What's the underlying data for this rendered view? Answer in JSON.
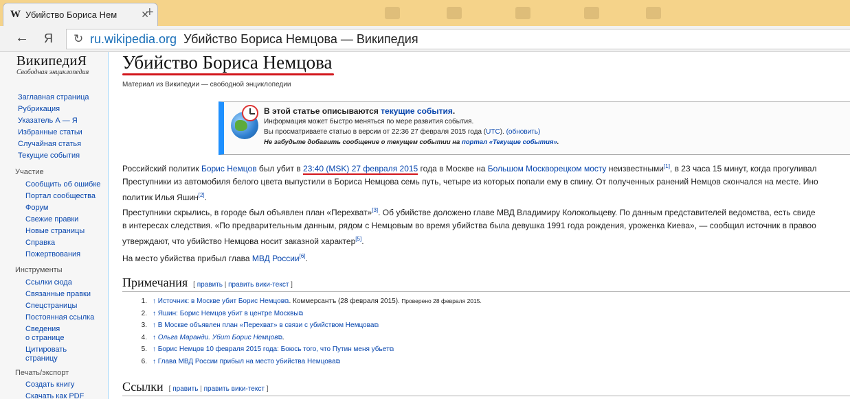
{
  "browser": {
    "tab_favicon": "W",
    "tab_title": "Убийство Бориса Нем",
    "tab_close": "✕",
    "new_tab": "+",
    "back_icon": "←",
    "yandex_label": "Я",
    "reload_icon": "↻",
    "domain": "ru.wikipedia.org",
    "page_title": "Убийство Бориса Немцова — Википедия"
  },
  "sidebar": {
    "logo_main": "ВикипедиЯ",
    "logo_sub": "Свободная энциклопедия",
    "main_nav": [
      "Заглавная страница",
      "Рубрикация",
      "Указатель А — Я",
      "Избранные статьи",
      "Случайная статья",
      "Текущие события"
    ],
    "participation": {
      "heading": "Участие",
      "items": [
        "Сообщить об ошибке",
        "Портал сообщества",
        "Форум",
        "Свежие правки",
        "Новые страницы",
        "Справка",
        "Пожертвования"
      ]
    },
    "tools": {
      "heading": "Инструменты",
      "items": [
        "Ссылки сюда",
        "Связанные правки",
        "Спецстраницы",
        "Постоянная ссылка"
      ],
      "item_info_1": "Сведения",
      "item_info_2": "о странице",
      "item_cite_1": "Цитировать",
      "item_cite_2": "страницу"
    },
    "print": {
      "heading": "Печать/экспорт",
      "items": [
        "Создать книгу",
        "Скачать как PDF"
      ]
    }
  },
  "article": {
    "title": "Убийство Бориса Немцова",
    "site_sub": "Материал из Википедии — свободной энциклопедии",
    "ambox": {
      "line1_a": "В этой статье описываются ",
      "line1_link": "текущие события",
      "line1_b": ".",
      "line2": "Информация может быстро меняться по мере развития события.",
      "line3_a": "Вы просматриваете статью в версии от 22:36 27 февраля 2015 года (",
      "line3_utc": "UTC",
      "line3_b": "). ",
      "line3_update": "(обновить)",
      "line4_a": "Не забудьте добавить сообщение о текущем событии на ",
      "line4_link": "портал «Текущие события»",
      "line4_b": "."
    },
    "p1": {
      "t1": "Российский политик ",
      "link1": "Борис Немцов",
      "t2": " был убит в ",
      "time": "23:40",
      "msk": "(MSK)",
      "date": "27 февраля 2015",
      "t3": " года в Москве на ",
      "link2": "Большом Москворецком мосту",
      "t4": " неизвестными",
      "ref1": "[1]",
      "t5": ", в 23 часа 15 минут, когда прогуливал",
      "line2": "Преступники из автомобиля белого цвета выпустили в Бориса Немцова семь путь, четыре из которых попали ему в спину. От полученных ранений Немцов скончался на месте. Ино",
      "line3": "политик Илья Яшин",
      "ref2": "[2]",
      "line3_end": "."
    },
    "p2": {
      "line1": "Преступники скрылись, в городе был объявлен план «Перехват»",
      "ref3": "[3]",
      "line1_end": ". Об убийстве доложено главе МВД Владимиру Колокольцеву. По данным представителей ведомства, есть свиде",
      "line2": "в интересах следствия. «По предварительным данным, рядом с Немцовым во время убийства была девушка 1991 года рождения, уроженка Киева», — сообщил источник в правоо",
      "line3": "утверждают, что убийство Немцова носит заказной характер",
      "ref5": "[5]",
      "line3_end": "."
    },
    "p3": {
      "t1": "На место убийства прибыл глава ",
      "link": "МВД России",
      "ref6": "[6]",
      "t2": "."
    },
    "notes": {
      "heading": "Примечания",
      "edit_open": "[ ",
      "edit": "править",
      "sep": " | ",
      "edit_source": "править вики-текст",
      "edit_close": " ]",
      "refs": [
        {
          "num": "1.",
          "arrow": "↑",
          "text": "Источник: в Москве убит Борис Немцов",
          "tail": ". Коммерсантъ (28 февраля 2015).",
          "small": " Проверено 28 февраля 2015."
        },
        {
          "num": "2.",
          "arrow": "↑",
          "text": "Яшин: Борис Немцов убит в центре Москвы",
          "tail": "",
          "small": ""
        },
        {
          "num": "3.",
          "arrow": "↑",
          "text": "В Москве объявлен план «Перехват» в связи с убийством Немцова",
          "tail": "",
          "small": ""
        },
        {
          "num": "4.",
          "arrow": "↑",
          "text": "Ольга Маранди. Убит Борис Немцов",
          "tail": ".",
          "small": ""
        },
        {
          "num": "5.",
          "arrow": "↑",
          "text": "Борис Немцов 10 февраля 2015 года: Боюсь того, что Путин меня убьет",
          "tail": "",
          "small": ""
        },
        {
          "num": "6.",
          "arrow": "↑",
          "text": "Глава МВД России прибыл на место убийства Немцова",
          "tail": "",
          "small": ""
        }
      ]
    },
    "links": {
      "heading": "Ссылки",
      "edit_open": "[ ",
      "edit": "править",
      "sep": " | ",
      "edit_source": "править вики-текст",
      "edit_close": " ]"
    }
  },
  "colors": {
    "link": "#0645ad",
    "underline_mark": "#d2151b",
    "ambox_accent": "#1e90ff",
    "tabbar": "#f5d38a"
  }
}
